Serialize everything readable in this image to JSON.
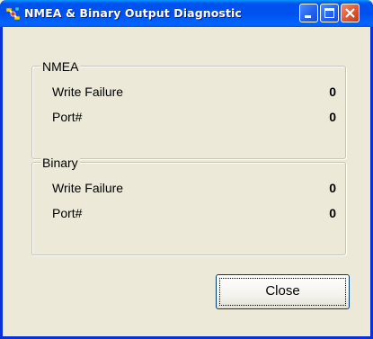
{
  "window": {
    "title": "NMEA & Binary Output Diagnostic",
    "controls": {
      "minimize_icon": "minimize-icon",
      "maximize_icon": "maximize-icon",
      "close_icon": "close-icon"
    },
    "app_icon": "satellite-icon"
  },
  "groups": {
    "nmea": {
      "legend": "NMEA",
      "rows": [
        {
          "label": "Write Failure",
          "value": "0"
        },
        {
          "label": "Port#",
          "value": "0"
        }
      ]
    },
    "binary": {
      "legend": "Binary",
      "rows": [
        {
          "label": "Write Failure",
          "value": "0"
        },
        {
          "label": "Port#",
          "value": "0"
        }
      ]
    }
  },
  "buttons": {
    "close_label": "Close"
  },
  "colors": {
    "titlebar": "#0053ee",
    "face": "#ece9d8",
    "close_control": "#e25a35"
  }
}
